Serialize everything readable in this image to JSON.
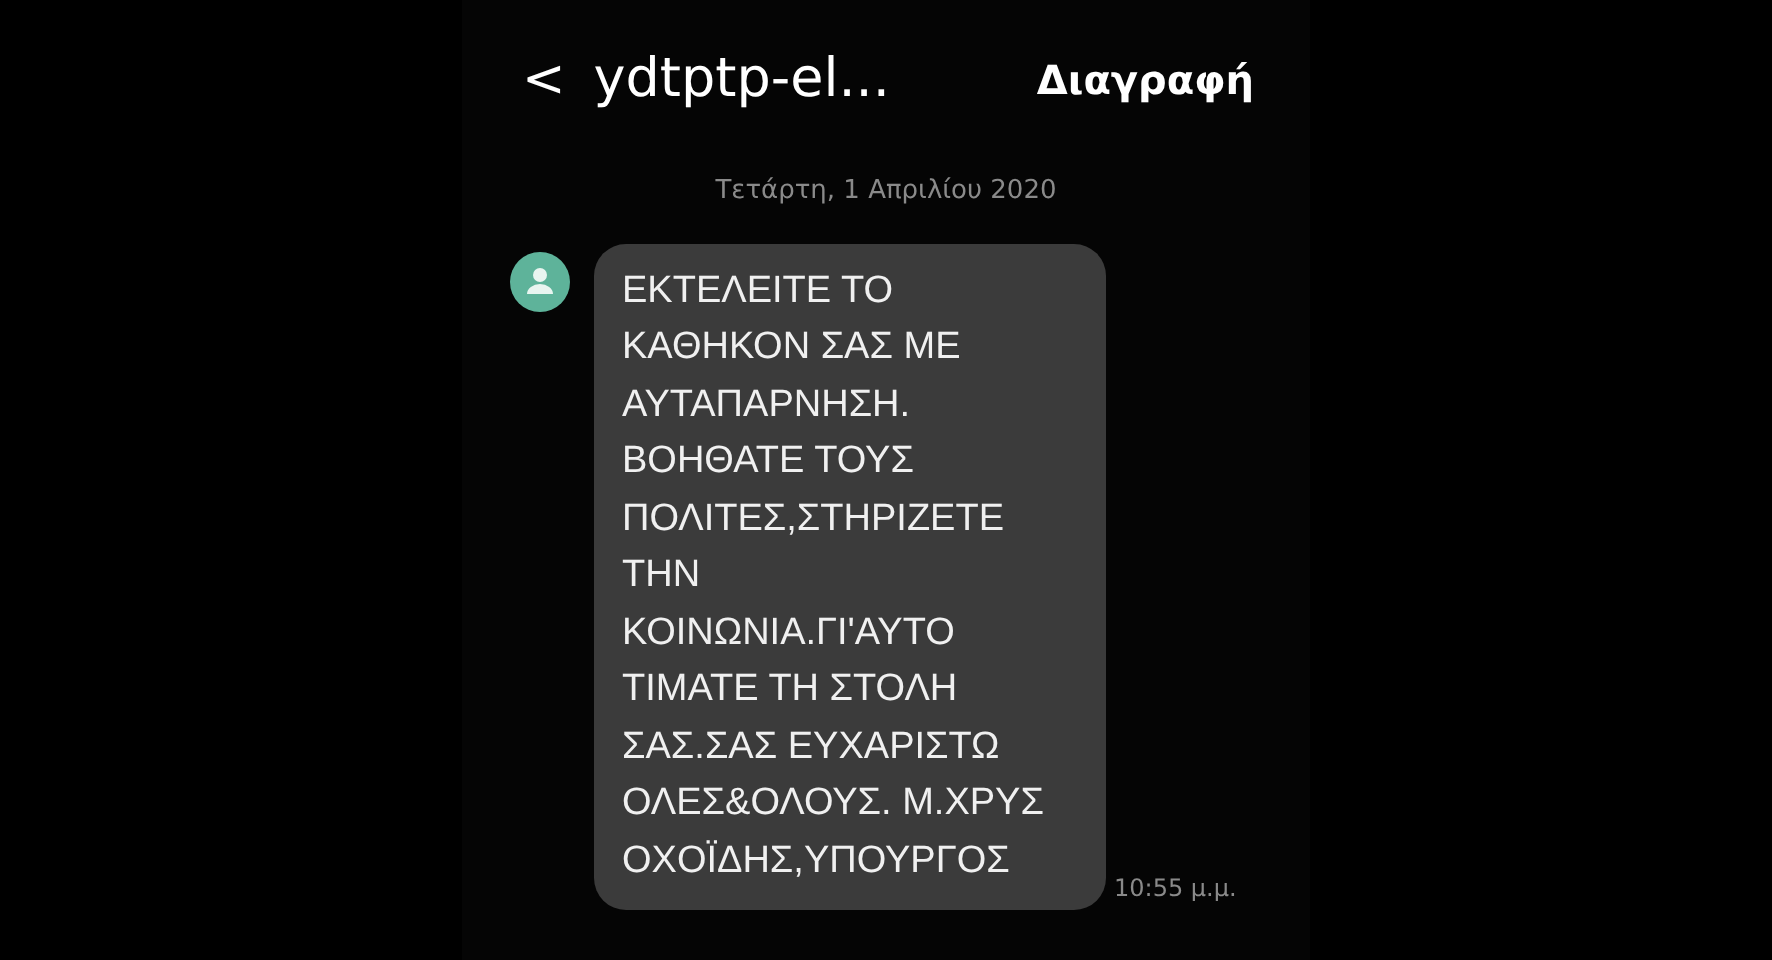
{
  "header": {
    "back": "<",
    "title": "ydtptp-el...",
    "action": "Διαγραφή"
  },
  "date": "Τετάρτη, 1 Απριλίου 2020",
  "messages": [
    {
      "kind": "incoming",
      "lines": [
        "ΕΚΤΕΛΕΙΤΕ ΤΟ",
        "ΚΑΘΗΚΟΝ ΣΑΣ ΜΕ",
        "ΑΥΤΑΠΑΡΝΗΣΗ.",
        "ΒΟΗΘΑΤΕ ΤΟΥΣ",
        "ΠΟΛΙΤΕΣ,ΣΤΗΡΙΖΕΤΕ",
        "ΤΗΝ",
        "ΚΟΙΝΩΝΙΑ.ΓΙ'ΑΥΤΟ",
        "ΤΙΜΑΤΕ ΤΗ ΣΤΟΛΗ",
        "ΣΑΣ.ΣΑΣ ΕΥΧΑΡΙΣΤΩ",
        "ΟΛΕΣ&ΟΛΟΥΣ. Μ.ΧΡΥΣ",
        "ΟΧΟΪΔΗΣ,ΥΠΟΥΡΓΟΣ"
      ],
      "time": "10:55 μ.μ."
    }
  ]
}
